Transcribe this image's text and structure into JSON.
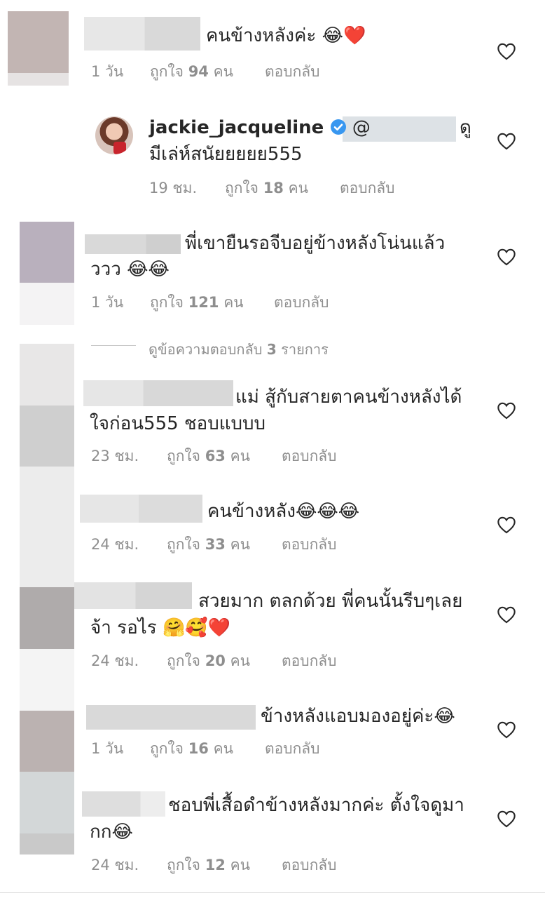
{
  "comments": [
    {
      "text": "คนข้างหลังค่ะ 😂❤️",
      "age": "1 วัน",
      "likes_label": "ถูกใจ",
      "likes": "94",
      "likes_unit": "คน",
      "reply": "ตอบกลับ"
    },
    {
      "username": "jackie_jacqueline",
      "mention": "@",
      "text_line1_tail": "ดู",
      "text_line2": "มีเล่ห์สนัยยยยย555",
      "age": "19 ชม.",
      "likes_label": "ถูกใจ",
      "likes": "18",
      "likes_unit": "คน",
      "reply": "ตอบกลับ"
    },
    {
      "text_line1": "พี่เขายืนรอจีบอยู่ข้างหลังโน่นแล้ว",
      "text_line2": "ววว 😂😂",
      "age": "1 วัน",
      "likes_label": "ถูกใจ",
      "likes": "121",
      "likes_unit": "คน",
      "reply": "ตอบกลับ"
    },
    {
      "text_line1": "แม่ สู้กับสายตาคนข้างหลังได้",
      "text_line2": "ใจก่อน555 ชอบแบบบ",
      "age": "23 ชม.",
      "likes_label": "ถูกใจ",
      "likes": "63",
      "likes_unit": "คน",
      "reply": "ตอบกลับ"
    },
    {
      "text": "คนข้างหลัง😂😂😂",
      "age": "24 ชม.",
      "likes_label": "ถูกใจ",
      "likes": "33",
      "likes_unit": "คน",
      "reply": "ตอบกลับ"
    },
    {
      "text_line1": "สวยมาก ตลกด้วย พี่คนนั้นรีบๆเลย",
      "text_line2": "จ้า รอไร 🤗🥰❤️",
      "age": "24 ชม.",
      "likes_label": "ถูกใจ",
      "likes": "20",
      "likes_unit": "คน",
      "reply": "ตอบกลับ"
    },
    {
      "text": "ข้างหลังแอบมองอยู่ค่ะ😂",
      "age": "1 วัน",
      "likes_label": "ถูกใจ",
      "likes": "16",
      "likes_unit": "คน",
      "reply": "ตอบกลับ"
    },
    {
      "text_line1": "ชอบพี่เสื้อดำข้างหลังมากค่ะ ตั้งใจดูมา",
      "text_line2": "กก😂",
      "age": "24 ชม.",
      "likes_label": "ถูกใจ",
      "likes": "12",
      "likes_unit": "คน",
      "reply": "ตอบกลับ"
    }
  ],
  "view_replies": {
    "prefix": "ดูข้อความตอบกลับ",
    "count": "3",
    "suffix": "รายการ"
  },
  "icons": {
    "like": "heart-outline-icon",
    "verified": "verified-badge-icon"
  },
  "colors": {
    "text": "#262626",
    "secondary": "#8e8e8e",
    "verified": "#3897f0"
  }
}
